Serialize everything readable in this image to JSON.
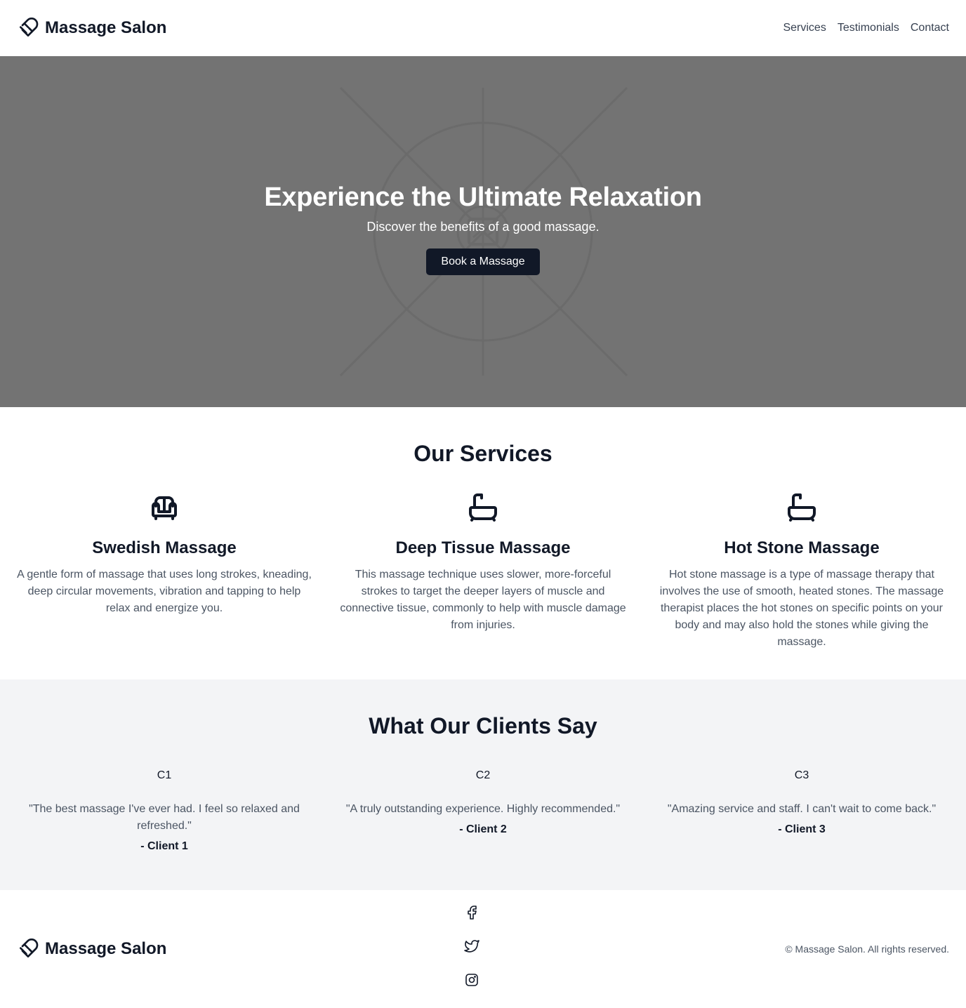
{
  "header": {
    "brand": "Massage Salon",
    "nav": [
      "Services",
      "Testimonials",
      "Contact"
    ]
  },
  "hero": {
    "title": "Experience the Ultimate Relaxation",
    "subtitle": "Discover the benefits of a good massage.",
    "cta": "Book a Massage"
  },
  "services": {
    "title": "Our Services",
    "items": [
      {
        "icon": "sofa-icon",
        "title": "Swedish Massage",
        "desc": "A gentle form of massage that uses long strokes, kneading, deep circular movements, vibration and tapping to help relax and energize you."
      },
      {
        "icon": "bathtub-icon",
        "title": "Deep Tissue Massage",
        "desc": "This massage technique uses slower, more-forceful strokes to target the deeper layers of muscle and connective tissue, commonly to help with muscle damage from injuries."
      },
      {
        "icon": "bathtub-icon",
        "title": "Hot Stone Massage",
        "desc": "Hot stone massage is a type of massage therapy that involves the use of smooth, heated stones. The massage therapist places the hot stones on specific points on your body and may also hold the stones while giving the massage."
      }
    ]
  },
  "testimonials": {
    "title": "What Our Clients Say",
    "items": [
      {
        "avatar": "C1",
        "quote": "\"The best massage I've ever had. I feel so relaxed and refreshed.\"",
        "author": "- Client 1"
      },
      {
        "avatar": "C2",
        "quote": "\"A truly outstanding experience. Highly recommended.\"",
        "author": "- Client 2"
      },
      {
        "avatar": "C3",
        "quote": "\"Amazing service and staff. I can't wait to come back.\"",
        "author": "- Client 3"
      }
    ]
  },
  "footer": {
    "brand": "Massage Salon",
    "socials": [
      "facebook-icon",
      "twitter-icon",
      "instagram-icon"
    ],
    "copyright": "© Massage Salon. All rights reserved."
  },
  "colors": {
    "primary_dark": "#111827",
    "hero_bg": "#737373",
    "muted_text": "#4b5563",
    "section_alt_bg": "#f3f4f6"
  }
}
